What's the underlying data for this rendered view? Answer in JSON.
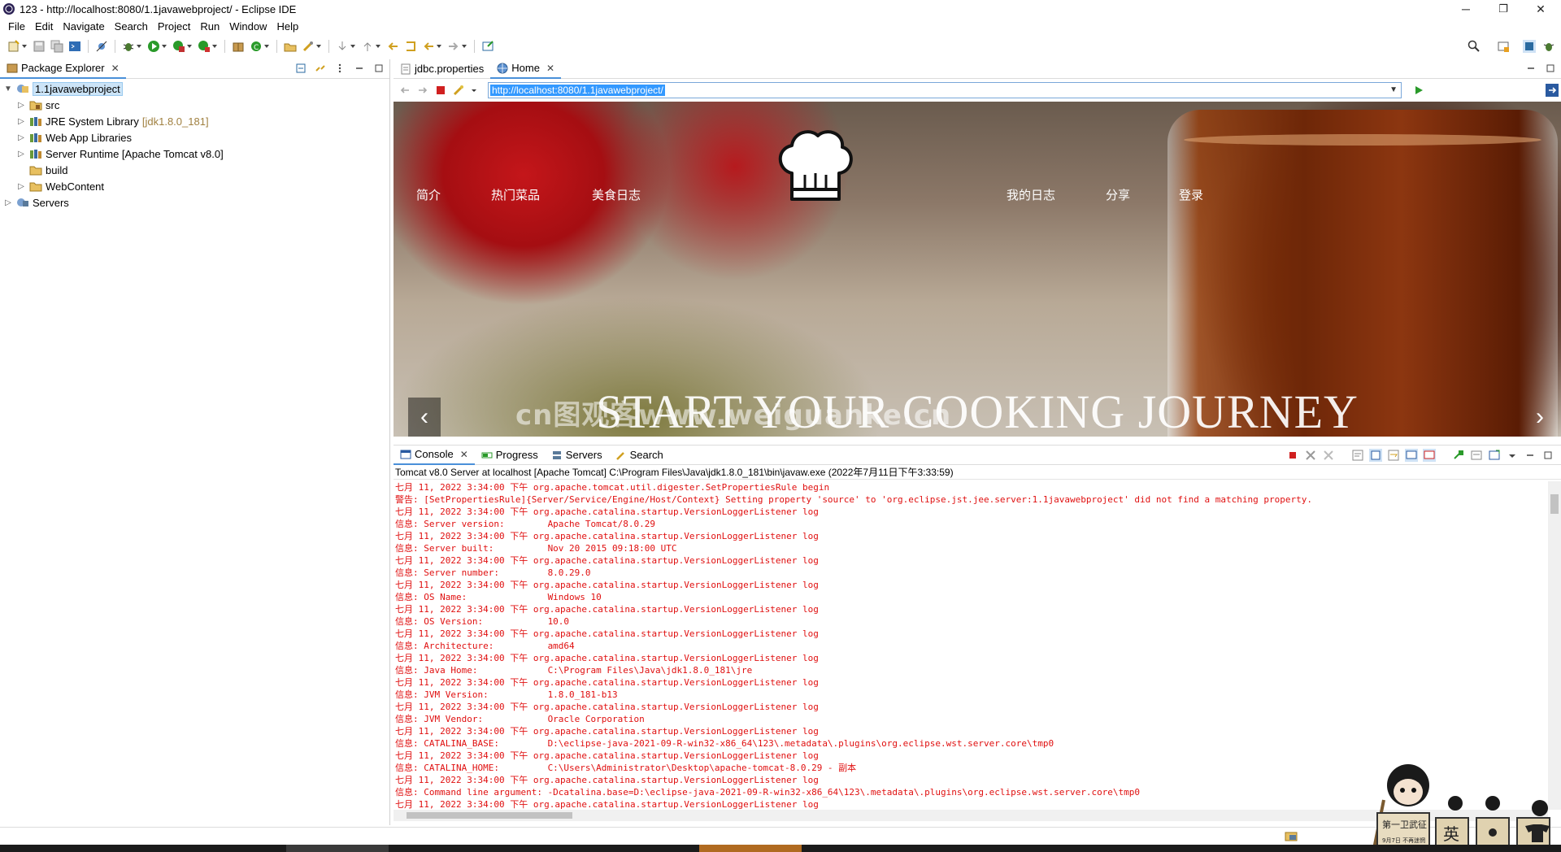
{
  "window": {
    "title": "123 - http://localhost:8080/1.1javawebproject/ - Eclipse IDE",
    "minimize": "─",
    "restore": "❐",
    "close": "✕"
  },
  "menu": [
    "File",
    "Edit",
    "Navigate",
    "Search",
    "Project",
    "Run",
    "Window",
    "Help"
  ],
  "package_explorer": {
    "tab_label": "Package Explorer",
    "tree": [
      {
        "label": "1.1javawebproject",
        "expanded": true,
        "level": 0,
        "selected": true,
        "icon": "project-icon"
      },
      {
        "label": "src",
        "level": 1,
        "icon": "source-folder-icon"
      },
      {
        "label": "JRE System Library",
        "decoration": "[jdk1.8.0_181]",
        "level": 1,
        "icon": "library-icon"
      },
      {
        "label": "Web App Libraries",
        "level": 1,
        "icon": "library-icon"
      },
      {
        "label": "Server Runtime [Apache Tomcat v8.0]",
        "level": 1,
        "icon": "library-icon"
      },
      {
        "label": "build",
        "level": 1,
        "icon": "folder-icon"
      },
      {
        "label": "WebContent",
        "level": 1,
        "icon": "folder-icon"
      },
      {
        "label": "Servers",
        "level": 0,
        "icon": "servers-project-icon"
      }
    ]
  },
  "editor": {
    "tabs": [
      {
        "label": "jdbc.properties",
        "active": false
      },
      {
        "label": "Home",
        "active": true
      }
    ],
    "url": "http://localhost:8080/1.1javawebproject/"
  },
  "webpage": {
    "nav_left": [
      "简介",
      "热门菜品",
      "美食日志"
    ],
    "nav_right": [
      "我的日志",
      "分享",
      "登录"
    ],
    "slogan": "START YOUR COOKING JOURNEY",
    "watermark": "cn图观客www.weiguanke.cn",
    "prev": "‹",
    "next": "›"
  },
  "console": {
    "tabs": [
      "Console",
      "Progress",
      "Servers",
      "Search"
    ],
    "header": "Tomcat v8.0 Server at localhost [Apache Tomcat] C:\\Program Files\\Java\\jdk1.8.0_181\\bin\\javaw.exe  (2022年7月11日下午3:33:59)",
    "lines": [
      "七月 11, 2022 3:34:00 下午 org.apache.tomcat.util.digester.SetPropertiesRule begin",
      "警告: [SetPropertiesRule]{Server/Service/Engine/Host/Context} Setting property 'source' to 'org.eclipse.jst.jee.server:1.1javawebproject' did not find a matching property.",
      "七月 11, 2022 3:34:00 下午 org.apache.catalina.startup.VersionLoggerListener log",
      "信息: Server version:        Apache Tomcat/8.0.29",
      "七月 11, 2022 3:34:00 下午 org.apache.catalina.startup.VersionLoggerListener log",
      "信息: Server built:          Nov 20 2015 09:18:00 UTC",
      "七月 11, 2022 3:34:00 下午 org.apache.catalina.startup.VersionLoggerListener log",
      "信息: Server number:         8.0.29.0",
      "七月 11, 2022 3:34:00 下午 org.apache.catalina.startup.VersionLoggerListener log",
      "信息: OS Name:               Windows 10",
      "七月 11, 2022 3:34:00 下午 org.apache.catalina.startup.VersionLoggerListener log",
      "信息: OS Version:            10.0",
      "七月 11, 2022 3:34:00 下午 org.apache.catalina.startup.VersionLoggerListener log",
      "信息: Architecture:          amd64",
      "七月 11, 2022 3:34:00 下午 org.apache.catalina.startup.VersionLoggerListener log",
      "信息: Java Home:             C:\\Program Files\\Java\\jdk1.8.0_181\\jre",
      "七月 11, 2022 3:34:00 下午 org.apache.catalina.startup.VersionLoggerListener log",
      "信息: JVM Version:           1.8.0_181-b13",
      "七月 11, 2022 3:34:00 下午 org.apache.catalina.startup.VersionLoggerListener log",
      "信息: JVM Vendor:            Oracle Corporation",
      "七月 11, 2022 3:34:00 下午 org.apache.catalina.startup.VersionLoggerListener log",
      "信息: CATALINA_BASE:         D:\\eclipse-java-2021-09-R-win32-x86_64\\123\\.metadata\\.plugins\\org.eclipse.wst.server.core\\tmp0",
      "七月 11, 2022 3:34:00 下午 org.apache.catalina.startup.VersionLoggerListener log",
      "信息: CATALINA_HOME:         C:\\Users\\Administrator\\Desktop\\apache-tomcat-8.0.29 - 副本",
      "七月 11, 2022 3:34:00 下午 org.apache.catalina.startup.VersionLoggerListener log",
      "信息: Command line argument: -Dcatalina.base=D:\\eclipse-java-2021-09-R-win32-x86_64\\123\\.metadata\\.plugins\\org.eclipse.wst.server.core\\tmp0",
      "七月 11, 2022 3:34:00 下午 org.apache.catalina.startup.VersionLoggerListener log"
    ]
  },
  "mascot": {
    "sign_line1": "第一卫武征",
    "sign_line2": "9月7日  不再迷惘",
    "ime_label": "英"
  },
  "colors": {
    "selection": "#3399ff",
    "console_error": "#e01010",
    "tab_accent": "#4a90d9"
  }
}
